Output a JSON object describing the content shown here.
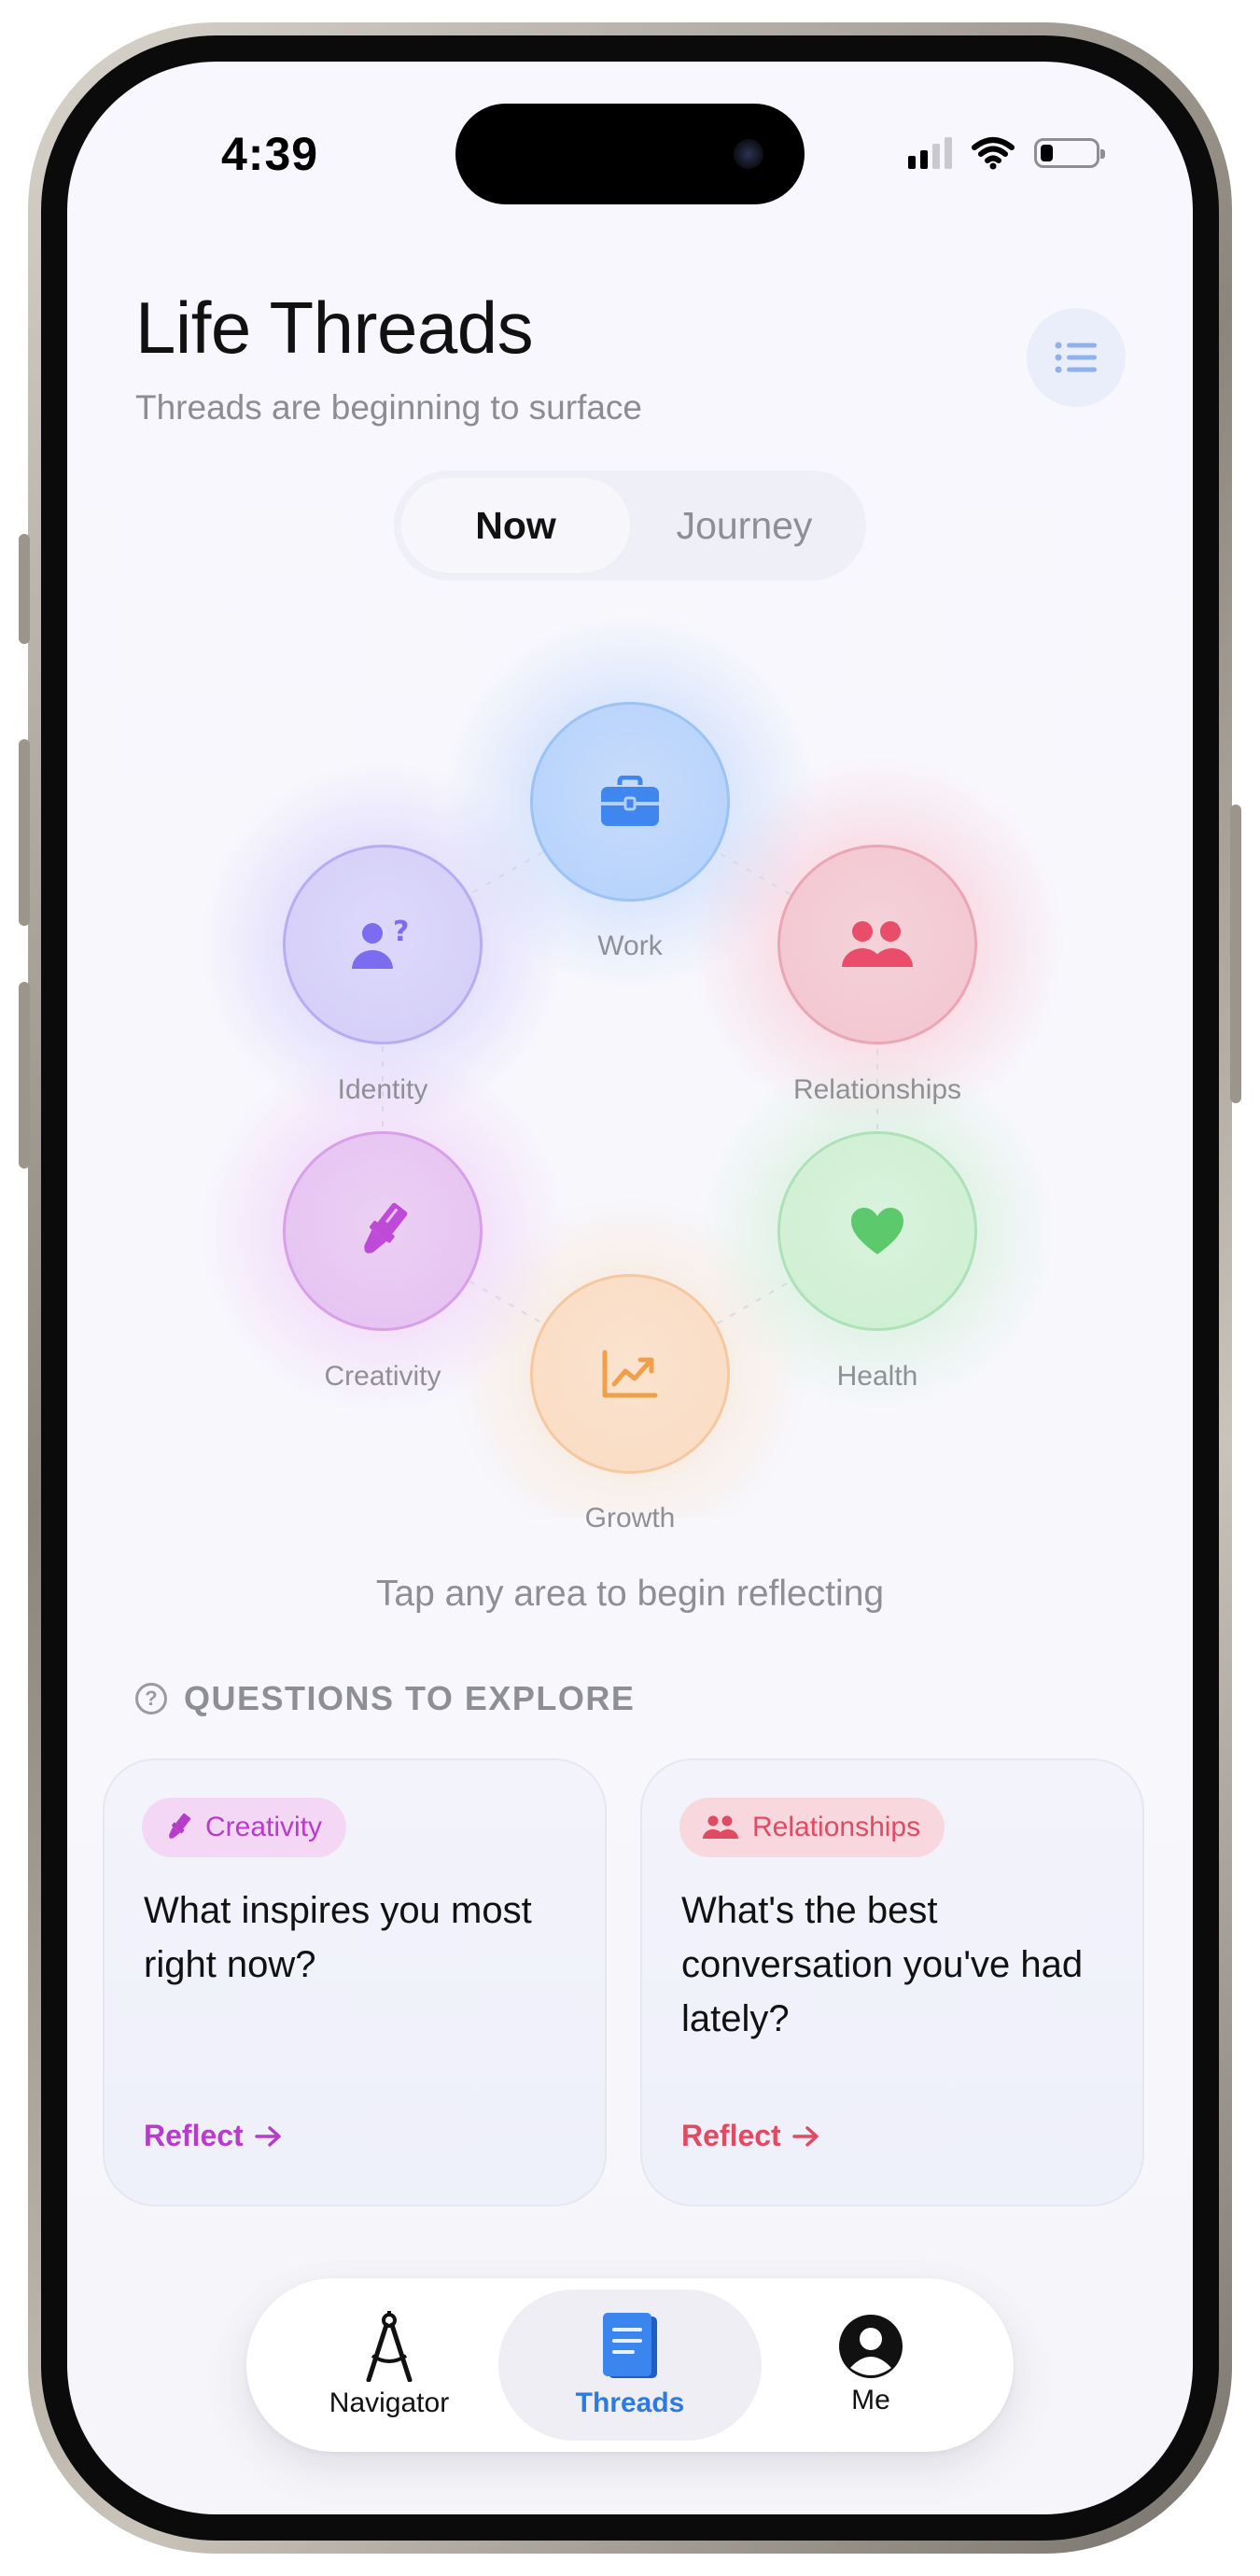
{
  "status_bar": {
    "time": "4:39"
  },
  "header": {
    "title": "Life Threads",
    "subtitle": "Threads are beginning to surface"
  },
  "segmented": {
    "items": [
      "Now",
      "Journey"
    ],
    "selected": "Now"
  },
  "life_areas": [
    {
      "label": "Work",
      "icon": "briefcase-icon",
      "color": "#4c8ff0"
    },
    {
      "label": "Relationships",
      "icon": "people-icon",
      "color": "#e85a72"
    },
    {
      "label": "Health",
      "icon": "heart-icon",
      "color": "#5cc96c"
    },
    {
      "label": "Growth",
      "icon": "chart-line-icon",
      "color": "#f0a04b"
    },
    {
      "label": "Creativity",
      "icon": "paintbrush-icon",
      "color": "#c04ad8"
    },
    {
      "label": "Identity",
      "icon": "person-question-icon",
      "color": "#7b6cf0"
    }
  ],
  "hint": "Tap any area to begin reflecting",
  "questions_section": {
    "heading": "QUESTIONS TO EXPLORE",
    "cards": [
      {
        "category": "Creativity",
        "question": "What inspires you most right now?",
        "action": "Reflect",
        "color": "#b73cc9"
      },
      {
        "category": "Relationships",
        "question": "What's the best conversation you've had lately?",
        "action": "Reflect",
        "color": "#e04a62"
      }
    ]
  },
  "tab_bar": {
    "items": [
      {
        "label": "Navigator",
        "icon": "compass-drafting-icon"
      },
      {
        "label": "Threads",
        "icon": "notebook-icon"
      },
      {
        "label": "Me",
        "icon": "profile-icon"
      }
    ],
    "selected": "Threads",
    "accent": "#2d7be0"
  }
}
